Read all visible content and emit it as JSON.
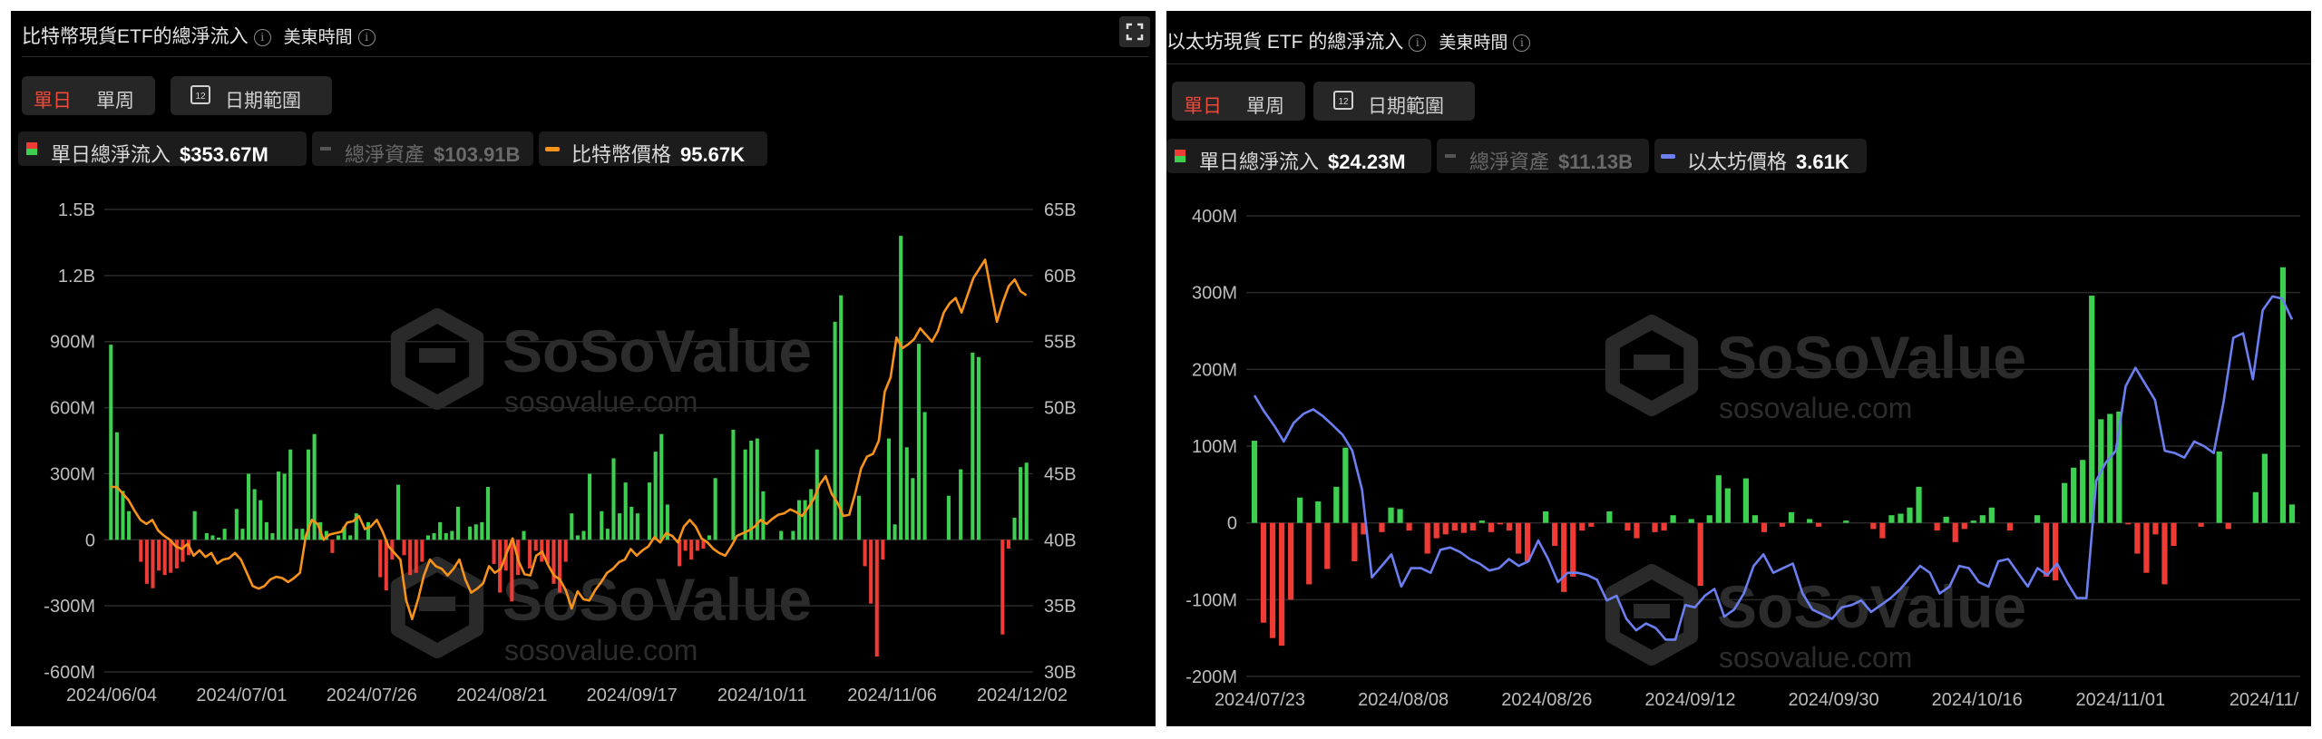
{
  "btc_panel": {
    "title": "比特幣現貨ETF的總淨流入",
    "timezone": "美東時間",
    "tab_daily": "單日",
    "tab_weekly": "單周",
    "calendar_day": "12",
    "date_range": "日期範圍",
    "legend_inflow_label": "單日總淨流入",
    "legend_inflow_value": "$353.67M",
    "legend_assets_label": "總淨資產",
    "legend_assets_value": "$103.91B",
    "legend_price_label": "比特幣價格",
    "legend_price_value": "95.67K",
    "watermark_brand": "SoSoValue",
    "watermark_url": "sosovalue.com"
  },
  "eth_panel": {
    "title": "以太坊現貨 ETF 的總淨流入",
    "timezone": "美東時間",
    "tab_daily": "單日",
    "tab_weekly": "單周",
    "calendar_day": "12",
    "date_range": "日期範圍",
    "legend_inflow_label": "單日總淨流入",
    "legend_inflow_value": "$24.23M",
    "legend_assets_label": "總淨資產",
    "legend_assets_value": "$11.13B",
    "legend_price_label": "以太坊價格",
    "legend_price_value": "3.61K",
    "watermark_brand": "SoSoValue",
    "watermark_url": "sosovalue.com"
  },
  "colors": {
    "inflow_positive": "#3dcf4f",
    "inflow_negative": "#ef3b35",
    "btc_price_line": "#f7931a",
    "eth_price_line": "#6b7ff0",
    "accent_tab": "#f04a3a"
  },
  "chart_data": [
    {
      "type": "bar",
      "name": "btc",
      "ylim": [
        -600,
        1500
      ],
      "y2lim": [
        30,
        65
      ],
      "yticks": [
        "1.5B",
        "1.2B",
        "900M",
        "600M",
        "300M",
        "0",
        "-300M",
        "-600M"
      ],
      "y2ticks": [
        "65B",
        "60B",
        "55B",
        "50B",
        "45B",
        "40B",
        "35B",
        "30B"
      ],
      "xticks": [
        "2024/06/04",
        "2024/07/01",
        "2024/07/26",
        "2024/08/21",
        "2024/09/17",
        "2024/10/11",
        "2024/11/06",
        "2024/12/02"
      ],
      "series": [
        {
          "values": [
            886,
            488,
            222,
            130,
            0,
            -100,
            -200,
            -220,
            -140,
            -160,
            -150,
            -130,
            -100,
            -70,
            130,
            0,
            30,
            20,
            10,
            50,
            0,
            140,
            50,
            300,
            230,
            180,
            80,
            30,
            310,
            300,
            410,
            50,
            50,
            410,
            480,
            80,
            40,
            -60,
            20,
            60,
            20,
            120,
            0,
            80,
            0,
            -170,
            -230,
            -90,
            250,
            -70,
            -160,
            -150,
            -100,
            20,
            30,
            80,
            30,
            40,
            150,
            0,
            60,
            70,
            80,
            240,
            -110,
            -240,
            -140,
            -280,
            -160,
            40,
            -130,
            -50,
            -100,
            -110,
            -200,
            -240,
            -100,
            120,
            20,
            40,
            300,
            0,
            130,
            50,
            370,
            120,
            260,
            150,
            120,
            0,
            260,
            400,
            480,
            160,
            0,
            -120,
            -50,
            -90,
            -50,
            -40,
            20,
            280,
            0,
            0,
            500,
            0,
            410,
            450,
            460,
            220,
            0,
            0,
            40,
            0,
            40,
            180,
            180,
            230,
            410,
            0,
            0,
            990,
            1110,
            0,
            0,
            200,
            -120,
            -290,
            -530,
            -90,
            460,
            70,
            1380,
            420,
            280,
            890,
            580,
            0,
            0,
            0,
            200,
            0,
            320,
            0,
            850,
            830,
            0,
            0,
            0,
            -430,
            -40,
            100,
            330,
            350
          ]
        },
        {
          "values": [
            44,
            44,
            43.5,
            43,
            42.2,
            41.5,
            41.2,
            41.5,
            40.7,
            40.3,
            40,
            39.5,
            39.3,
            39.7,
            38.8,
            39.2,
            38.7,
            39,
            38.2,
            38.5,
            38.6,
            39,
            38.5,
            37.5,
            36.5,
            36.3,
            36.5,
            37,
            37.2,
            37.1,
            36.8,
            37.1,
            37.5,
            40.3,
            41.5,
            41.2,
            40,
            40.4,
            40.5,
            40.6,
            41.3,
            41.4,
            41.8,
            40.8,
            41,
            41.5,
            40.6,
            39.5,
            39,
            38.5,
            35.4,
            34,
            35.5,
            37.3,
            38.5,
            38,
            37.8,
            37.3,
            37.8,
            38.5,
            37,
            36,
            36.3,
            36.7,
            38,
            37.5,
            37.8,
            39,
            40.1,
            38.4,
            37.4,
            37.3,
            38.8,
            39.1,
            38.1,
            37.3,
            37,
            36.2,
            34.8,
            36.1,
            35.5,
            35.4,
            36.2,
            36.8,
            37.5,
            37.8,
            38.3,
            38.5,
            39.3,
            38.8,
            39.2,
            39.5,
            40.2,
            39.8,
            40.5,
            40.3,
            39.8,
            41,
            41.5,
            41,
            40.1,
            39.8,
            39.3,
            39,
            38.8,
            39.5,
            40.3,
            40.5,
            40.7,
            41,
            41.5,
            41.2,
            41.6,
            41.9,
            42,
            42.3,
            42.1,
            41.8,
            42.4,
            43.1,
            44.2,
            44.8,
            43.5,
            42.8,
            41.8,
            41.9,
            43.5,
            45.4,
            46.3,
            46.5,
            47.5,
            51.2,
            52.3,
            55.3,
            54.5,
            54.8,
            55.2,
            56,
            55.5,
            55,
            55.8,
            57.2,
            57.9,
            58.3,
            57.2,
            58.5,
            59.8,
            60.5,
            61.2,
            58.8,
            56.5,
            58,
            59.2,
            59.7,
            58.8,
            58.5
          ]
        }
      ]
    },
    {
      "type": "bar",
      "name": "eth",
      "ylim": [
        -200,
        400
      ],
      "y2lim": [
        2150,
        4150
      ],
      "yticks": [
        "400M",
        "300M",
        "200M",
        "100M",
        "0",
        "-100M",
        "-200M"
      ],
      "xticks": [
        "2024/07/23",
        "2024/08/08",
        "2024/08/26",
        "2024/09/12",
        "2024/09/30",
        "2024/10/16",
        "2024/11/01",
        "2024/11/"
      ],
      "series": [
        {
          "values": [
            107,
            -130,
            -150,
            -160,
            -100,
            33,
            -80,
            28,
            -60,
            47,
            98,
            -50,
            -15,
            0,
            -12,
            20,
            18,
            -10,
            0,
            -40,
            -20,
            -15,
            -10,
            -13,
            -10,
            3,
            -12,
            -2,
            -10,
            -40,
            -50,
            0,
            15,
            -30,
            -90,
            -70,
            -10,
            -5,
            0,
            15,
            0,
            -10,
            -20,
            0,
            -12,
            -10,
            10,
            0,
            5,
            -82,
            10,
            62,
            45,
            0,
            58,
            10,
            -12,
            0,
            -5,
            14,
            0,
            5,
            -5,
            0,
            0,
            3,
            0,
            0,
            -8,
            -20,
            10,
            12,
            20,
            47,
            0,
            -10,
            8,
            -25,
            -8,
            3,
            10,
            20,
            0,
            -10,
            0,
            0,
            10,
            -70,
            -75,
            52,
            72,
            82,
            296,
            135,
            142,
            145,
            -2,
            -40,
            -65,
            -15,
            -80,
            -30,
            0,
            0,
            -5,
            0,
            93,
            -8,
            0,
            0,
            40,
            90,
            0,
            333,
            24
          ]
        },
        {
          "values": [
            3370,
            3300,
            3240,
            3170,
            3250,
            3290,
            3310,
            3280,
            3240,
            3200,
            3130,
            2960,
            2580,
            2630,
            2680,
            2540,
            2620,
            2620,
            2600,
            2700,
            2710,
            2690,
            2660,
            2640,
            2610,
            2620,
            2660,
            2630,
            2650,
            2740,
            2660,
            2560,
            2600,
            2600,
            2590,
            2570,
            2480,
            2500,
            2400,
            2350,
            2380,
            2360,
            2310,
            2310,
            2460,
            2450,
            2500,
            2530,
            2410,
            2440,
            2510,
            2630,
            2680,
            2600,
            2620,
            2640,
            2510,
            2440,
            2420,
            2400,
            2450,
            2460,
            2480,
            2430,
            2460,
            2490,
            2530,
            2580,
            2630,
            2600,
            2510,
            2540,
            2630,
            2620,
            2560,
            2540,
            2650,
            2660,
            2600,
            2540,
            2620,
            2590,
            2640,
            2560,
            2490,
            2490,
            3000,
            3080,
            3130,
            3410,
            3490,
            3420,
            3350,
            3130,
            3120,
            3100,
            3170,
            3150,
            3120,
            3340,
            3620,
            3640,
            3440,
            3740,
            3800,
            3790,
            3700
          ]
        }
      ]
    }
  ]
}
